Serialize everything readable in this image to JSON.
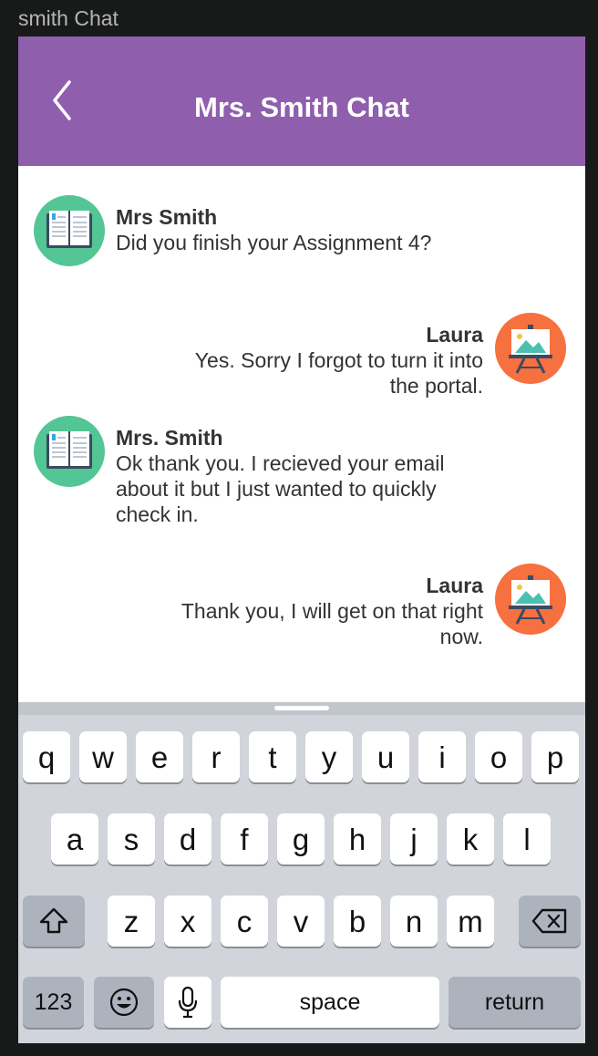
{
  "window": {
    "title": "smith Chat"
  },
  "header": {
    "title": "Mrs. Smith Chat",
    "back_icon": "chevron-left-icon"
  },
  "colors": {
    "header": "#8f5ead",
    "teacher_avatar": "#54c595",
    "student_avatar": "#f7703f",
    "keyboard_bg": "#d1d4da"
  },
  "messages": [
    {
      "sender": "Mrs Smith",
      "text": "Did you finish your Assignment 4?",
      "side": "left",
      "avatar": "book-icon"
    },
    {
      "sender": "Laura",
      "text": "Yes. Sorry I forgot to turn it into the portal.",
      "side": "right",
      "avatar": "easel-icon"
    },
    {
      "sender": "Mrs. Smith",
      "text": "Ok thank you. I recieved your email about it but I just wanted to quickly check in.",
      "side": "left",
      "avatar": "book-icon"
    },
    {
      "sender": "Laura",
      "text": "Thank you, I will get on that right now.",
      "side": "right",
      "avatar": "easel-icon"
    }
  ],
  "keyboard": {
    "row1": [
      "q",
      "w",
      "e",
      "r",
      "t",
      "y",
      "u",
      "i",
      "o",
      "p"
    ],
    "row2": [
      "a",
      "s",
      "d",
      "f",
      "g",
      "h",
      "j",
      "k",
      "l"
    ],
    "row3": [
      "z",
      "x",
      "c",
      "v",
      "b",
      "n",
      "m"
    ],
    "numbers_label": "123",
    "space_label": "space",
    "return_label": "return",
    "shift_icon": "shift-icon",
    "delete_icon": "backspace-icon",
    "emoji_icon": "emoji-icon",
    "mic_icon": "microphone-icon"
  }
}
